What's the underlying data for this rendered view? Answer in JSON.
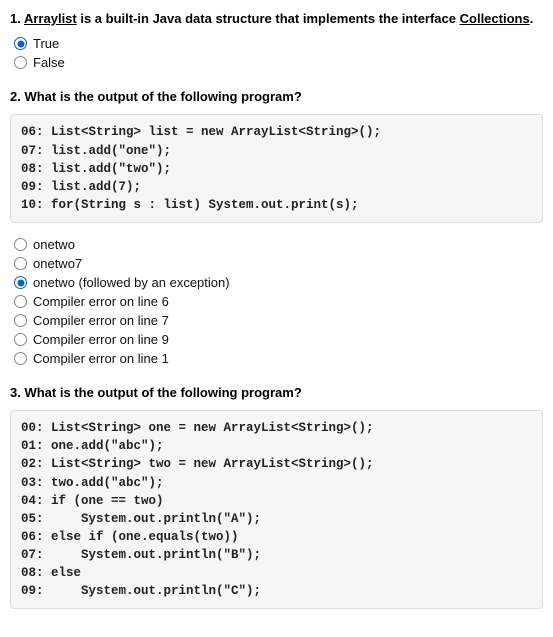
{
  "q1": {
    "number": "1.",
    "prefix": "Arraylist",
    "mid": " is a built-in Java data structure that implements the interface ",
    "suffix": "Collections",
    "tail": ".",
    "options": [
      {
        "label": "True",
        "selected": true
      },
      {
        "label": "False",
        "selected": false
      }
    ]
  },
  "q2": {
    "number": "2.",
    "text": "What is the output of the following program?",
    "code": "06: List<String> list = new ArrayList<String>();\n07: list.add(\"one\");\n08: list.add(\"two\");\n09: list.add(7);\n10: for(String s : list) System.out.print(s);",
    "options": [
      {
        "label": "onetwo",
        "selected": false
      },
      {
        "label": "onetwo7",
        "selected": false
      },
      {
        "label": "onetwo (followed by an exception)",
        "selected": true
      },
      {
        "label": "Compiler error on line 6",
        "selected": false
      },
      {
        "label": "Compiler error on line 7",
        "selected": false
      },
      {
        "label": "Compiler error on line 9",
        "selected": false
      },
      {
        "label": "Compiler error on line 1",
        "selected": false
      }
    ]
  },
  "q3": {
    "number": "3.",
    "text": "What is the output of the following program?",
    "code": "00: List<String> one = new ArrayList<String>();\n01: one.add(\"abc\");\n02: List<String> two = new ArrayList<String>();\n03: two.add(\"abc\");\n04: if (one == two)\n05:     System.out.println(\"A\");\n06: else if (one.equals(two))\n07:     System.out.println(\"B\");\n08: else\n09:     System.out.println(\"C\");"
  }
}
